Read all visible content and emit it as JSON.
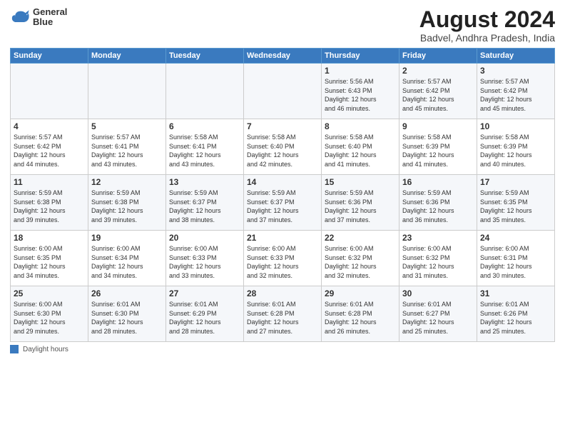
{
  "header": {
    "logo_line1": "General",
    "logo_line2": "Blue",
    "title": "August 2024",
    "subtitle": "Badvel, Andhra Pradesh, India"
  },
  "weekdays": [
    "Sunday",
    "Monday",
    "Tuesday",
    "Wednesday",
    "Thursday",
    "Friday",
    "Saturday"
  ],
  "legend": "Daylight hours",
  "weeks": [
    [
      {
        "day": "",
        "info": ""
      },
      {
        "day": "",
        "info": ""
      },
      {
        "day": "",
        "info": ""
      },
      {
        "day": "",
        "info": ""
      },
      {
        "day": "1",
        "info": "Sunrise: 5:56 AM\nSunset: 6:43 PM\nDaylight: 12 hours\nand 46 minutes."
      },
      {
        "day": "2",
        "info": "Sunrise: 5:57 AM\nSunset: 6:42 PM\nDaylight: 12 hours\nand 45 minutes."
      },
      {
        "day": "3",
        "info": "Sunrise: 5:57 AM\nSunset: 6:42 PM\nDaylight: 12 hours\nand 45 minutes."
      }
    ],
    [
      {
        "day": "4",
        "info": "Sunrise: 5:57 AM\nSunset: 6:42 PM\nDaylight: 12 hours\nand 44 minutes."
      },
      {
        "day": "5",
        "info": "Sunrise: 5:57 AM\nSunset: 6:41 PM\nDaylight: 12 hours\nand 43 minutes."
      },
      {
        "day": "6",
        "info": "Sunrise: 5:58 AM\nSunset: 6:41 PM\nDaylight: 12 hours\nand 43 minutes."
      },
      {
        "day": "7",
        "info": "Sunrise: 5:58 AM\nSunset: 6:40 PM\nDaylight: 12 hours\nand 42 minutes."
      },
      {
        "day": "8",
        "info": "Sunrise: 5:58 AM\nSunset: 6:40 PM\nDaylight: 12 hours\nand 41 minutes."
      },
      {
        "day": "9",
        "info": "Sunrise: 5:58 AM\nSunset: 6:39 PM\nDaylight: 12 hours\nand 41 minutes."
      },
      {
        "day": "10",
        "info": "Sunrise: 5:58 AM\nSunset: 6:39 PM\nDaylight: 12 hours\nand 40 minutes."
      }
    ],
    [
      {
        "day": "11",
        "info": "Sunrise: 5:59 AM\nSunset: 6:38 PM\nDaylight: 12 hours\nand 39 minutes."
      },
      {
        "day": "12",
        "info": "Sunrise: 5:59 AM\nSunset: 6:38 PM\nDaylight: 12 hours\nand 39 minutes."
      },
      {
        "day": "13",
        "info": "Sunrise: 5:59 AM\nSunset: 6:37 PM\nDaylight: 12 hours\nand 38 minutes."
      },
      {
        "day": "14",
        "info": "Sunrise: 5:59 AM\nSunset: 6:37 PM\nDaylight: 12 hours\nand 37 minutes."
      },
      {
        "day": "15",
        "info": "Sunrise: 5:59 AM\nSunset: 6:36 PM\nDaylight: 12 hours\nand 37 minutes."
      },
      {
        "day": "16",
        "info": "Sunrise: 5:59 AM\nSunset: 6:36 PM\nDaylight: 12 hours\nand 36 minutes."
      },
      {
        "day": "17",
        "info": "Sunrise: 5:59 AM\nSunset: 6:35 PM\nDaylight: 12 hours\nand 35 minutes."
      }
    ],
    [
      {
        "day": "18",
        "info": "Sunrise: 6:00 AM\nSunset: 6:35 PM\nDaylight: 12 hours\nand 34 minutes."
      },
      {
        "day": "19",
        "info": "Sunrise: 6:00 AM\nSunset: 6:34 PM\nDaylight: 12 hours\nand 34 minutes."
      },
      {
        "day": "20",
        "info": "Sunrise: 6:00 AM\nSunset: 6:33 PM\nDaylight: 12 hours\nand 33 minutes."
      },
      {
        "day": "21",
        "info": "Sunrise: 6:00 AM\nSunset: 6:33 PM\nDaylight: 12 hours\nand 32 minutes."
      },
      {
        "day": "22",
        "info": "Sunrise: 6:00 AM\nSunset: 6:32 PM\nDaylight: 12 hours\nand 32 minutes."
      },
      {
        "day": "23",
        "info": "Sunrise: 6:00 AM\nSunset: 6:32 PM\nDaylight: 12 hours\nand 31 minutes."
      },
      {
        "day": "24",
        "info": "Sunrise: 6:00 AM\nSunset: 6:31 PM\nDaylight: 12 hours\nand 30 minutes."
      }
    ],
    [
      {
        "day": "25",
        "info": "Sunrise: 6:00 AM\nSunset: 6:30 PM\nDaylight: 12 hours\nand 29 minutes."
      },
      {
        "day": "26",
        "info": "Sunrise: 6:01 AM\nSunset: 6:30 PM\nDaylight: 12 hours\nand 28 minutes."
      },
      {
        "day": "27",
        "info": "Sunrise: 6:01 AM\nSunset: 6:29 PM\nDaylight: 12 hours\nand 28 minutes."
      },
      {
        "day": "28",
        "info": "Sunrise: 6:01 AM\nSunset: 6:28 PM\nDaylight: 12 hours\nand 27 minutes."
      },
      {
        "day": "29",
        "info": "Sunrise: 6:01 AM\nSunset: 6:28 PM\nDaylight: 12 hours\nand 26 minutes."
      },
      {
        "day": "30",
        "info": "Sunrise: 6:01 AM\nSunset: 6:27 PM\nDaylight: 12 hours\nand 25 minutes."
      },
      {
        "day": "31",
        "info": "Sunrise: 6:01 AM\nSunset: 6:26 PM\nDaylight: 12 hours\nand 25 minutes."
      }
    ]
  ]
}
